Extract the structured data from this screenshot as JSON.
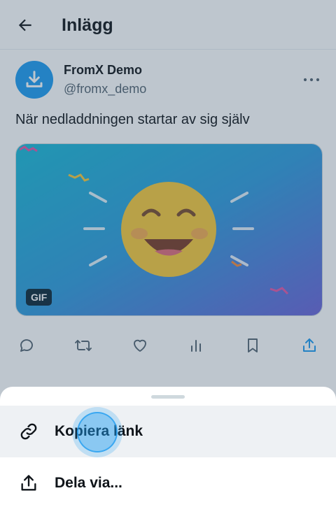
{
  "header": {
    "title": "Inlägg",
    "back_icon": "arrow-left-icon"
  },
  "post": {
    "author_name": "FromX Demo",
    "author_handle": "@fromx_demo",
    "avatar_icon": "download-icon",
    "more_icon": "more-horizontal-icon",
    "text": "När nedladdningen startar av sig själv",
    "media": {
      "type": "gif",
      "badge": "GIF",
      "content_icon": "laughing-emoji"
    }
  },
  "actions": [
    {
      "name": "reply",
      "icon": "reply-icon"
    },
    {
      "name": "repost",
      "icon": "repost-icon"
    },
    {
      "name": "like",
      "icon": "heart-icon"
    },
    {
      "name": "views",
      "icon": "bar-chart-icon"
    },
    {
      "name": "bookmark",
      "icon": "bookmark-icon"
    },
    {
      "name": "share",
      "icon": "share-icon"
    }
  ],
  "share_sheet": {
    "items": [
      {
        "label": "Kopiera länk",
        "icon": "link-icon"
      },
      {
        "label": "Dela via...",
        "icon": "share-icon"
      }
    ]
  },
  "colors": {
    "accent": "#1d9bf0",
    "text": "#0f1419",
    "muted": "#536471",
    "overlay": "#364d66"
  }
}
